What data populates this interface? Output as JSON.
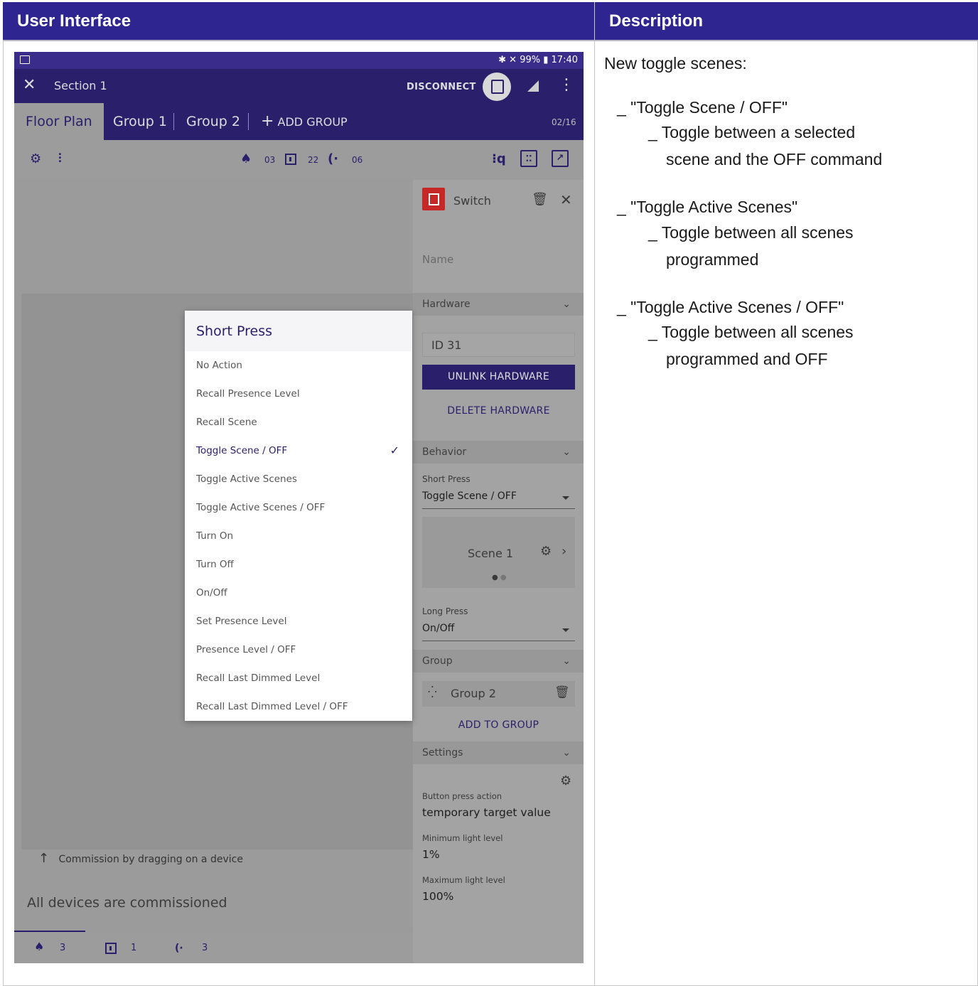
{
  "headers": {
    "left": "User Interface",
    "right": "Description"
  },
  "status_bar": {
    "battery": "99%",
    "time": "17:40"
  },
  "app_bar": {
    "title": "Section 1",
    "disconnect": "DISCONNECT"
  },
  "tabs": [
    {
      "label": "Floor Plan",
      "active": true
    },
    {
      "label": "Group 1",
      "active": false
    },
    {
      "label": "Group 2",
      "active": false
    }
  ],
  "add_group": "ADD GROUP",
  "tab_count": "02/16",
  "toolbar": {
    "lights_count": "03",
    "switches_count": "22",
    "sensors_count": "06"
  },
  "canvas": {
    "hint": "Commission by dragging on a device",
    "all_commissioned": "All devices are commissioned"
  },
  "bottom_bar": {
    "lights": "3",
    "switches": "1",
    "sensors": "3"
  },
  "panel": {
    "device_title": "Switch",
    "name_placeholder": "Name",
    "hardware": {
      "header": "Hardware",
      "id": "ID 31",
      "unlink": "UNLINK HARDWARE",
      "delete": "DELETE HARDWARE"
    },
    "behavior": {
      "header": "Behavior",
      "short_press_label": "Short Press",
      "short_press_value": "Toggle Scene / OFF",
      "scene": "Scene 1",
      "long_press_label": "Long Press",
      "long_press_value": "On/Off"
    },
    "group": {
      "header": "Group",
      "name": "Group 2",
      "add": "ADD TO GROUP"
    },
    "settings": {
      "header": "Settings",
      "button_press_label": "Button press action",
      "button_press_value": "temporary target value",
      "min_label": "Minimum light level",
      "min_value": "1%",
      "max_label": "Maximum light level",
      "max_value": "100%"
    }
  },
  "dialog": {
    "title": "Short Press",
    "options": [
      {
        "label": "No Action",
        "selected": false
      },
      {
        "label": "Recall Presence Level",
        "selected": false
      },
      {
        "label": "Recall Scene",
        "selected": false
      },
      {
        "label": "Toggle Scene / OFF",
        "selected": true
      },
      {
        "label": "Toggle Active Scenes",
        "selected": false
      },
      {
        "label": "Toggle Active Scenes / OFF",
        "selected": false
      },
      {
        "label": "Turn On",
        "selected": false
      },
      {
        "label": "Turn Off",
        "selected": false
      },
      {
        "label": "On/Off",
        "selected": false
      },
      {
        "label": "Set Presence Level",
        "selected": false
      },
      {
        "label": "Presence Level / OFF",
        "selected": false
      },
      {
        "label": "Recall Last Dimmed Level",
        "selected": false
      },
      {
        "label": "Recall Last Dimmed Level / OFF",
        "selected": false
      }
    ]
  },
  "description": {
    "intro": "New toggle scenes:",
    "item1_title": "_ \"Toggle Scene / OFF\"",
    "item1_line1": "_ Toggle between a selected",
    "item1_line2": "scene and the OFF command",
    "item2_title": "_ \"Toggle Active Scenes\"",
    "item2_line1": "_ Toggle between all scenes",
    "item2_line2": "programmed",
    "item3_title": "_ \"Toggle Active Scenes / OFF\"",
    "item3_line1": "_ Toggle between all scenes",
    "item3_line2": "programmed and OFF"
  },
  "colors": {
    "header_bg": "#2e2590",
    "app_primary": "#2a1f6b",
    "switch_red": "#c62828"
  }
}
